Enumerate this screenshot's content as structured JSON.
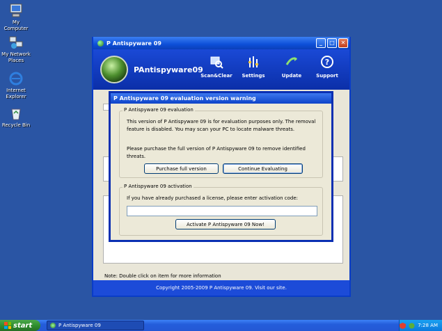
{
  "desktop": {
    "icons": [
      {
        "label": "My Computer"
      },
      {
        "label": "My Network Places"
      },
      {
        "label": "Internet Explorer"
      },
      {
        "label": "Recycle Bin"
      }
    ]
  },
  "window": {
    "title": "P Antispyware 09",
    "app_name": "PAntispyware09",
    "nav": [
      {
        "label": "Scan&Clear",
        "icon": "scan-icon"
      },
      {
        "label": "Settings",
        "icon": "settings-icon"
      },
      {
        "label": "Update",
        "icon": "update-icon"
      },
      {
        "label": "Support",
        "icon": "support-icon"
      }
    ],
    "note": "Note: Double click on item for more information",
    "footer": "Copyright 2005-2009 P Antispyware 09. Visit our site."
  },
  "dialog": {
    "title": "P Antispyware 09 evaluation version warning",
    "evaluation": {
      "legend": "P Antispyware 09 evaluation",
      "text1": "This version of P Antispyware 09 is for evaluation purposes only. The removal feature is disabled. You may scan your PC to locate malware threats.",
      "text2": "Please purchase the full version of P Antispyware 09 to remove identified threats.",
      "purchase_button": "Purchase full version",
      "continue_button": "Continue Evaluating"
    },
    "activation": {
      "legend": "P Antispyware 09 activation",
      "text": "If you have already purchased a license, please enter activation code:",
      "input_value": "",
      "activate_button": "Activate P Antispyware 09 Now!"
    }
  },
  "taskbar": {
    "start_label": "start",
    "task_label": "P Antispyware 09",
    "clock": "7:28 AM"
  }
}
